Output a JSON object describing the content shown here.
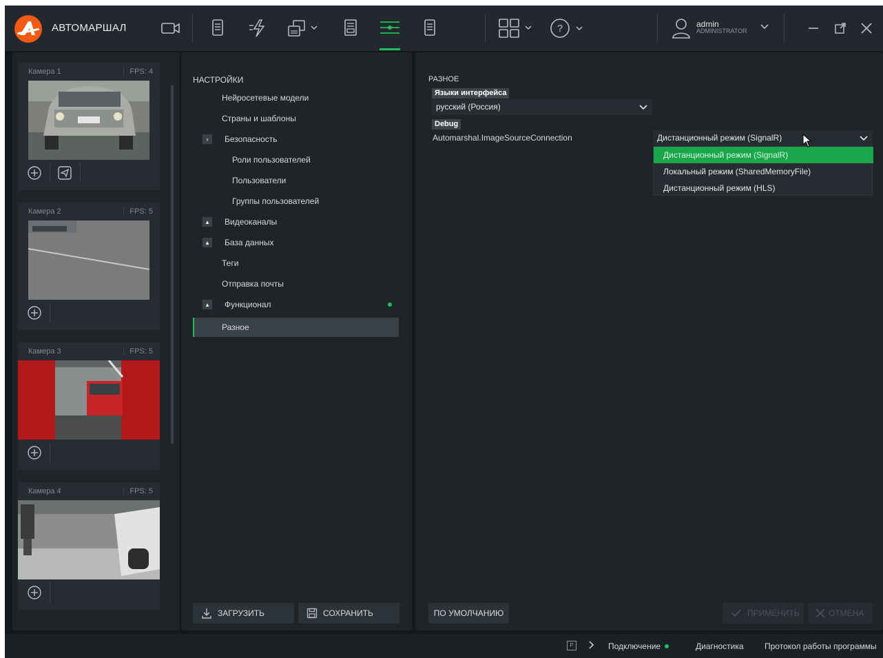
{
  "app": {
    "title": "АВТОМАРШАЛ"
  },
  "user": {
    "name": "admin",
    "role": "ADMINISTRATOR"
  },
  "colors": {
    "accent": "#1fbf57",
    "logo": "#f05a14",
    "background": "#14181c",
    "panel": "#1e2428"
  },
  "toolbar_icons": [
    "camera-icon",
    "document-icon",
    "lightning-icon",
    "layout-grid-icon",
    "report-icon",
    "settings-sliders-icon",
    "clipboard-icon",
    "grid-view-icon",
    "help-icon"
  ],
  "cameras": [
    {
      "title": "Камера 1",
      "fps": "FPS: 4"
    },
    {
      "title": "Камера 2",
      "fps": "FPS: 5"
    },
    {
      "title": "Камера 3",
      "fps": "FPS: 5"
    },
    {
      "title": "Камера 4",
      "fps": "FPS: 5"
    }
  ],
  "nav": {
    "header": "НАСТРОЙКИ",
    "items": [
      {
        "label": "Нейросетевые модели"
      },
      {
        "label": "Страны и шаблоны"
      },
      {
        "label": "Безопасность",
        "toggle": "›"
      },
      {
        "label": "Роли пользователей"
      },
      {
        "label": "Пользователи"
      },
      {
        "label": "Группы пользователей"
      },
      {
        "label": "Видеоканалы",
        "toggle": "▴"
      },
      {
        "label": "База данных",
        "toggle": "▴"
      },
      {
        "label": "Теги"
      },
      {
        "label": "Отправка почты"
      },
      {
        "label": "Функционал",
        "toggle": "▴"
      },
      {
        "label": "Разное"
      }
    ],
    "load_label": "ЗАГРУЗИТЬ",
    "save_label": "СОХРАНИТЬ"
  },
  "main": {
    "section": "РАЗНОЕ",
    "lang_tag": "Языки интерфейса",
    "lang_value": "русский (Россия)",
    "debug_tag": "Debug",
    "setting_label": "Automarshal.ImageSourceConnection",
    "setting_value": "Дистанционный режим (SignalR)",
    "options": [
      "Дистанционный режим (SignalR)",
      "Локальный режим (SharedMemoryFile)",
      "Дистанционный режим (HLS)"
    ],
    "default_label": "ПО УМОЛЧАНИЮ",
    "apply_label": "ПРИМЕНИТЬ",
    "cancel_label": "ОТМЕНА"
  },
  "status": {
    "p_label": "P",
    "connection": "Подключение",
    "diagnostics": "Диагностика",
    "protocol": "Протокол работы программы"
  }
}
